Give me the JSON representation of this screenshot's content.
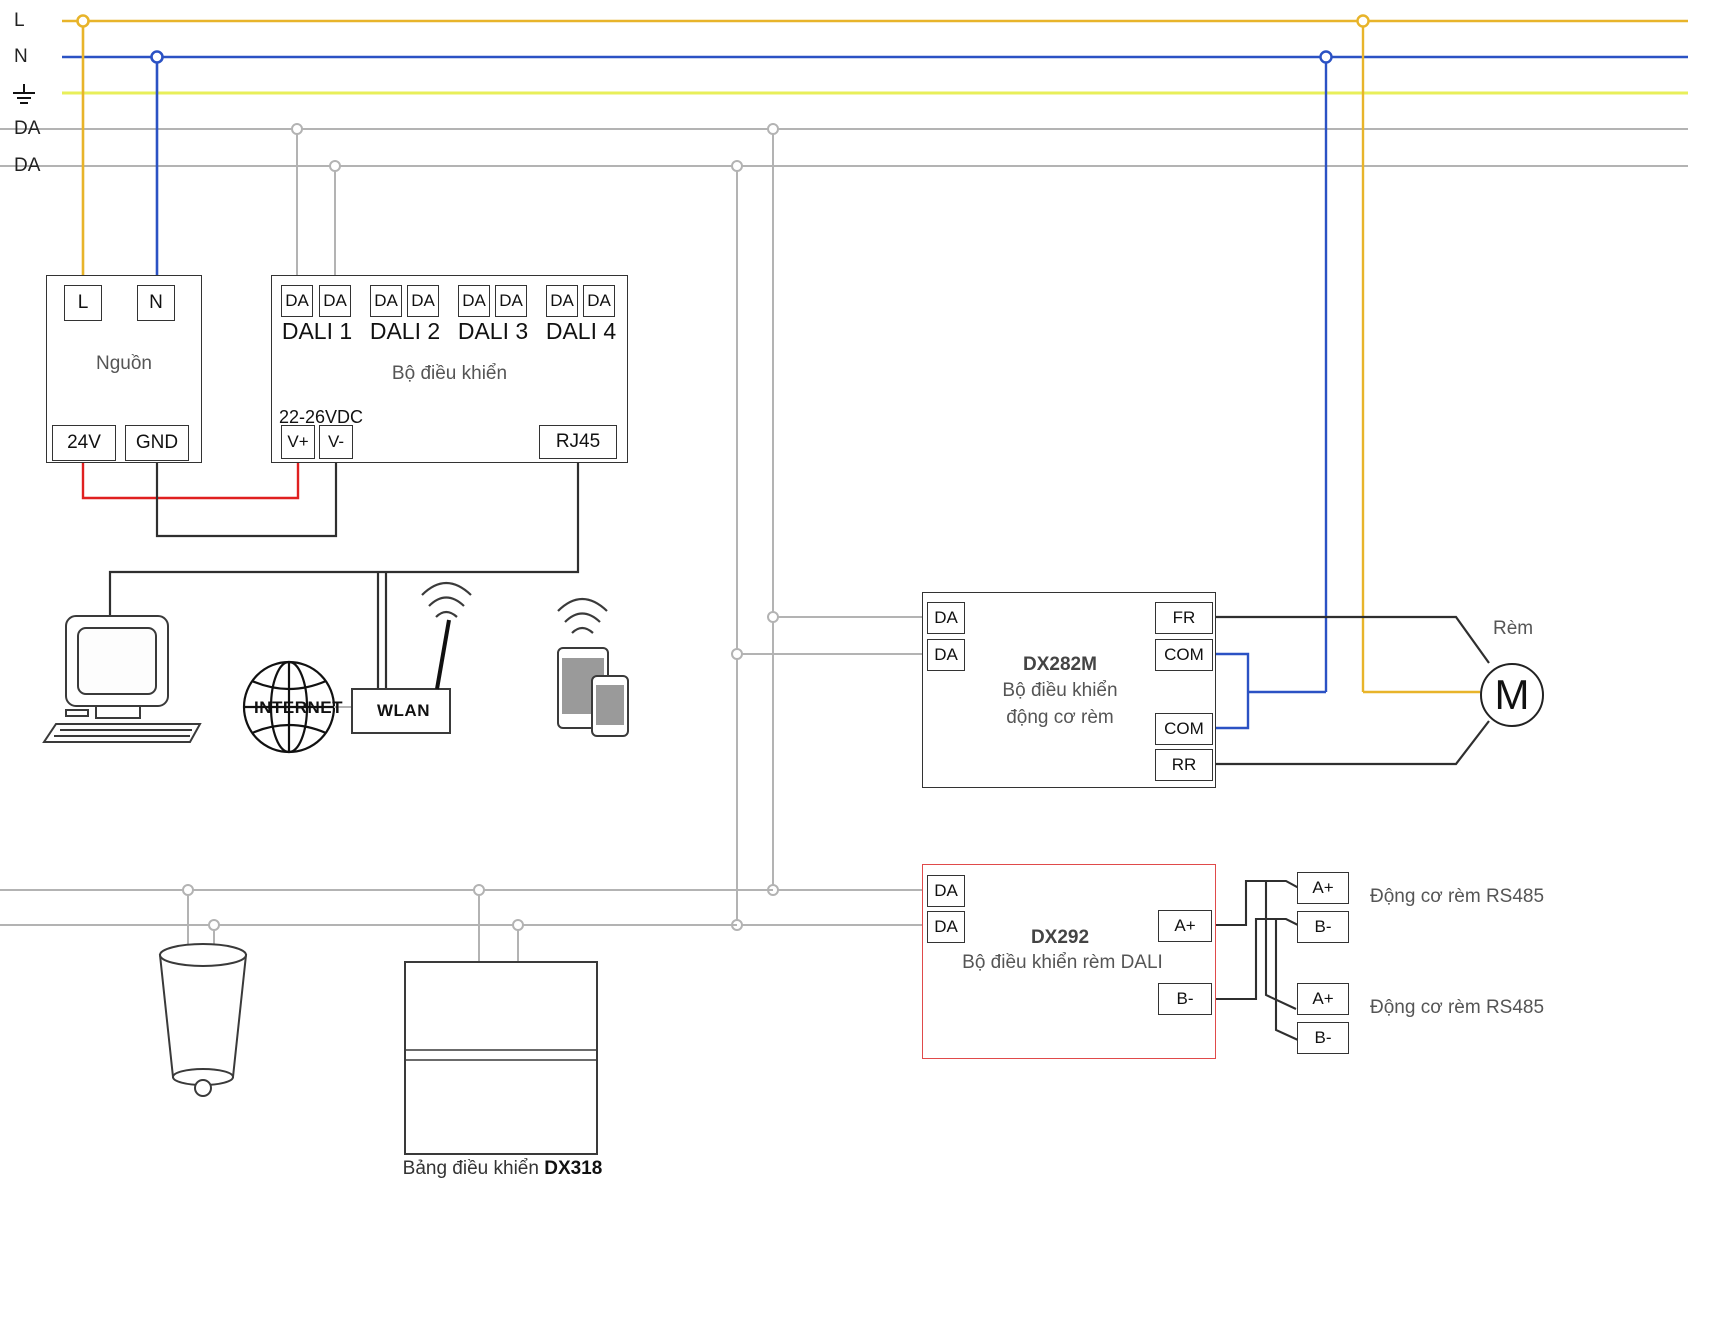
{
  "diagram": {
    "title": "DALI curtain / lighting control wiring diagram",
    "colors": {
      "line_L": "#e8b42a",
      "line_N": "#2b52c4",
      "line_PE": "#e8ef5a",
      "line_DA": "#b3b3b3",
      "line_dc": "#e02020",
      "line_signal": "#3a3a3a",
      "accent_red": "#e04a4a"
    }
  },
  "bus": {
    "labels": [
      {
        "name": "L",
        "text": "L"
      },
      {
        "name": "N",
        "text": "N"
      },
      {
        "name": "PE",
        "text": ""
      },
      {
        "name": "DA1",
        "text": "DA"
      },
      {
        "name": "DA2",
        "text": "DA"
      }
    ]
  },
  "power_supply": {
    "title": "Nguồn",
    "terminals_top": [
      "L",
      "N"
    ],
    "terminals_bottom": [
      "24V",
      "GND"
    ]
  },
  "controller": {
    "title": "Bộ điều khiển",
    "voltage_label": "22-26VDC",
    "dali_channels": [
      {
        "label": "DALI 1",
        "terminals": [
          "DA",
          "DA"
        ]
      },
      {
        "label": "DALI 2",
        "terminals": [
          "DA",
          "DA"
        ]
      },
      {
        "label": "DALI 3",
        "terminals": [
          "DA",
          "DA"
        ]
      },
      {
        "label": "DALI 4",
        "terminals": [
          "DA",
          "DA"
        ]
      }
    ],
    "power_terminals": [
      "V+",
      "V-"
    ],
    "network_terminal": "RJ45"
  },
  "network": {
    "internet_label": "INTERNET",
    "wlan_label": "WLAN"
  },
  "dx282m": {
    "model": "DX282M",
    "desc_line1": "Bộ điều khiển",
    "desc_line2": "động cơ rèm",
    "inputs": [
      "DA",
      "DA"
    ],
    "outputs": [
      "FR",
      "COM",
      "COM",
      "RR"
    ]
  },
  "curtain_motor": {
    "label": "Rèm",
    "symbol": "M"
  },
  "dx292": {
    "model": "DX292",
    "desc": "Bộ điều khiển rèm DALI",
    "inputs": [
      "DA",
      "DA"
    ],
    "outputs": [
      "A+",
      "B-"
    ]
  },
  "rs485_motors": [
    {
      "label": "Động cơ rèm RS485",
      "terminals": [
        "A+",
        "B-"
      ]
    },
    {
      "label": "Động cơ rèm RS485",
      "terminals": [
        "A+",
        "B-"
      ]
    }
  ],
  "control_panel": {
    "caption_prefix": "Bảng điều khiển ",
    "caption_model": "DX318"
  }
}
